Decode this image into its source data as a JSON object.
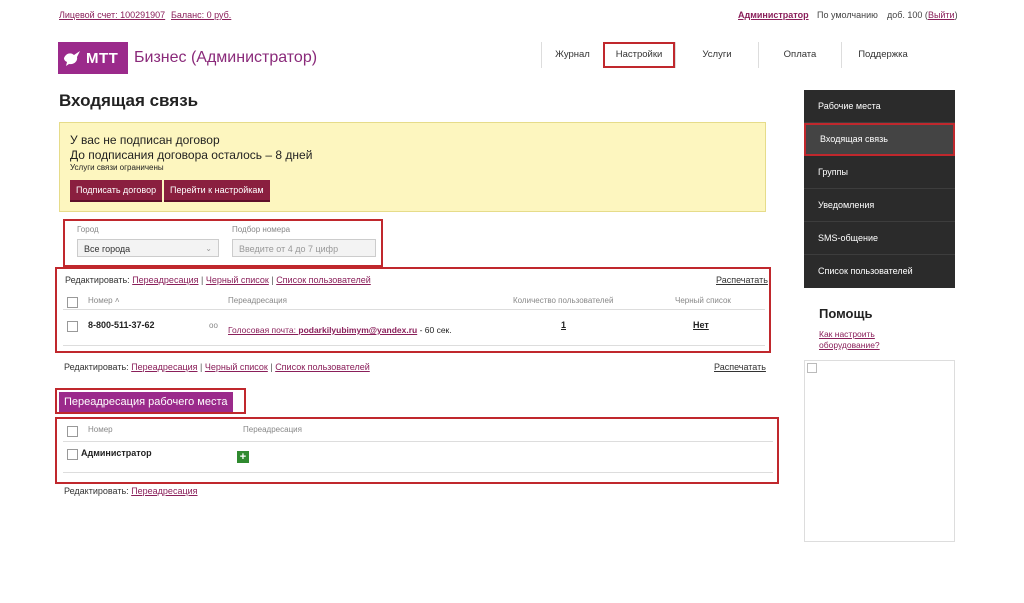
{
  "topbar": {
    "account_label": "Лицевой счет: 100291907",
    "balance_label": "Баланс: 0 руб.",
    "admin_link": "Администратор",
    "default_label": "По умолчанию",
    "ext_label": "доб. 100 (",
    "logout_link": "Выйти",
    "ext_close": ")"
  },
  "logo": {
    "brand": "МТТ",
    "title": "Бизнес (Администратор)"
  },
  "nav": {
    "items": [
      {
        "label": "Журнал"
      },
      {
        "label": "Настройки"
      },
      {
        "label": "Услуги"
      },
      {
        "label": "Оплата"
      },
      {
        "label": "Поддержка"
      }
    ]
  },
  "page": {
    "title": "Входящая связь"
  },
  "notice": {
    "line1": "У вас не подписан договор",
    "line2": "До подписания договора осталось – 8 дней",
    "line3": "Услуги связи ограничены",
    "sign_button": "Подписать договор",
    "settings_button": "Перейти к настройкам"
  },
  "filters": {
    "city_label": "Город",
    "city_value": "Все города",
    "number_label": "Подбор номера",
    "number_placeholder": "Введите от 4 до 7 цифр"
  },
  "edit": {
    "prefix": "Редактировать:",
    "forwarding": "Переадресация",
    "blacklist": "Черный список",
    "users_list": "Список пользователей",
    "print": "Распечатать",
    "pipe": "|"
  },
  "numbers_table": {
    "headers": {
      "number": "Номер",
      "forwarding": "Переадресация",
      "users_count": "Количество пользователей",
      "blacklist": "Черный список"
    },
    "rows": [
      {
        "number": "8-800-511-37-62",
        "forwarding_prefix": "Голосовая почта: ",
        "email": "podarkilyubimym@yandex.ru",
        "forwarding_suffix": " - 60 сек.",
        "users_count": "1",
        "blacklist": "Нет"
      }
    ]
  },
  "workplace": {
    "title": "Переадресация рабочего места",
    "headers": {
      "number": "Номер",
      "forwarding": "Переадресация"
    },
    "rows": [
      {
        "name": "Администратор",
        "action": "+"
      }
    ]
  },
  "sidebar": {
    "items": [
      {
        "label": "Рабочие места"
      },
      {
        "label": "Входящая связь"
      },
      {
        "label": "Группы"
      },
      {
        "label": "Уведомления"
      },
      {
        "label": "SMS-общение"
      },
      {
        "label": "Список пользователей"
      }
    ]
  },
  "help": {
    "title": "Помощь",
    "link_line1": "Как настроить",
    "link_line2": "оборудование?"
  },
  "colors": {
    "brand": "#9b2a8b",
    "highlight": "#c0282d",
    "notice_bg": "#fdf6bf",
    "sidebar_bg": "#2b2b2b"
  }
}
